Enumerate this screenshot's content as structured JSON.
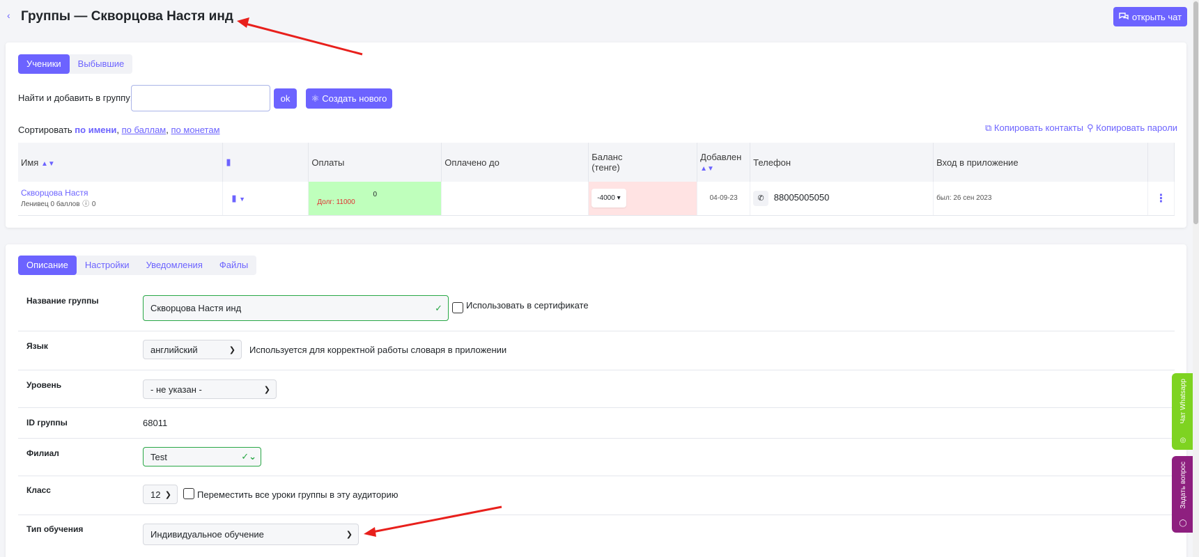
{
  "header": {
    "back_icon": "chevron-left-icon",
    "title": "Группы — Скворцова Настя инд",
    "open_chat_label": "открыть чат",
    "open_chat_icon": "chat-bubbles-icon"
  },
  "students_tabs": [
    "Ученики",
    "Выбывшие"
  ],
  "search": {
    "label": "Найти и добавить в группу:",
    "value": "",
    "ok_label": "ok",
    "create_label": "Создать нового",
    "create_icon": "user-plus-icon"
  },
  "sort": {
    "prefix": "Сортировать",
    "by_name": "по имени",
    "by_points": "по баллам",
    "by_coins": "по монетам",
    "sep1": ",",
    "sep2": ","
  },
  "copy": {
    "contacts": "Копировать контакты",
    "passwords": "Копировать пароли",
    "contacts_icon": "copy-icon",
    "passwords_icon": "key-icon"
  },
  "table": {
    "headers": {
      "name": "Имя",
      "payments": "Оплаты",
      "paid_until": "Оплачено до",
      "balance_line1": "Баланс",
      "balance_line2": "(тенге)",
      "added": "Добавлен",
      "phone": "Телефон",
      "app_login": "Вход в приложение"
    },
    "row": {
      "name": "Скворцова Настя",
      "sub": "Ленивец 0 баллов",
      "coins": "0",
      "payment_value": "0",
      "debt": "Долг: 11000",
      "paid_until": "",
      "balance": "-4000",
      "added": "04-09-23",
      "phone": "88005005050",
      "login": "был: 26 сен 2023"
    }
  },
  "desc_tabs": [
    "Описание",
    "Настройки",
    "Уведомления",
    "Файлы"
  ],
  "form": {
    "group_name_label": "Название группы",
    "group_name_value": "Скворцова Настя инд",
    "use_in_cert_label": "Использовать в сертификате",
    "language_label": "Язык",
    "language_value": "английский",
    "language_hint": "Используется для корректной работы словаря в приложении",
    "level_label": "Уровень",
    "level_value": "- не указан -",
    "id_label": "ID группы",
    "id_value": "68011",
    "branch_label": "Филиал",
    "branch_value": "Test",
    "class_label": "Класс",
    "class_value": "12",
    "move_lessons_label": "Переместить все уроки группы в эту аудиторию",
    "learning_type_label": "Тип обучения",
    "learning_type_value": "Индивидуальное обучение"
  },
  "side_buttons": {
    "whatsapp": "Чат Whatsapp",
    "whatsapp_color": "#7ed321",
    "ask": "Задать вопрос",
    "ask_color": "#8e1f7f"
  },
  "colors": {
    "accent": "#6c63ff",
    "success": "#28a745",
    "annotation_arrow": "#e8201c"
  }
}
